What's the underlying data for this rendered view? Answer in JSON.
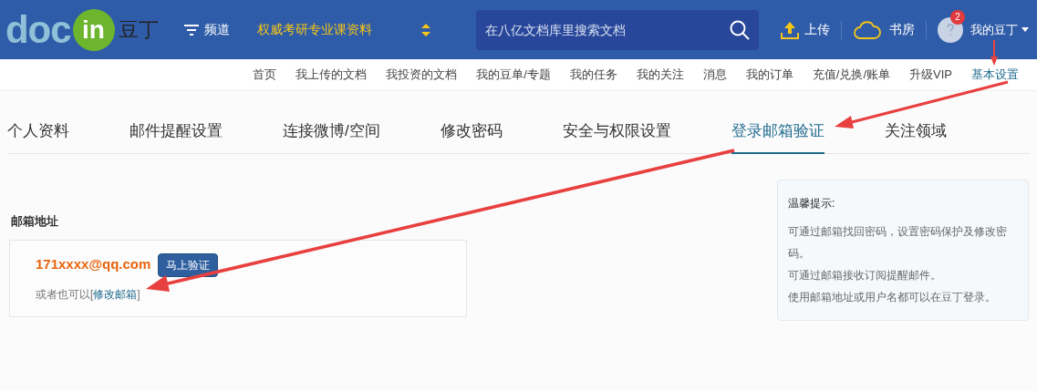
{
  "header": {
    "logo": {
      "part_1": "doc",
      "part_2": "in",
      "part_3": "豆丁"
    },
    "channel_menu": "频道",
    "promo": "权威考研专业课资料",
    "search": {
      "placeholder": "在八亿文档库里搜索文档"
    },
    "upload": "上传",
    "bookshelf": "书房",
    "account": {
      "name": "我的豆丁",
      "badge": "2"
    }
  },
  "nav": [
    {
      "label": "首页",
      "selected": false
    },
    {
      "label": "我上传的文档",
      "selected": false
    },
    {
      "label": "我投资的文档",
      "selected": false
    },
    {
      "label": "我的豆单/专题",
      "selected": false
    },
    {
      "label": "我的任务",
      "selected": false
    },
    {
      "label": "我的关注",
      "selected": false
    },
    {
      "label": "消息",
      "selected": false
    },
    {
      "label": "我的订单",
      "selected": false
    },
    {
      "label": "充值/兑换/账单",
      "selected": false
    },
    {
      "label": "升级VIP",
      "selected": false
    },
    {
      "label": "基本设置",
      "selected": true
    }
  ],
  "tabs": [
    {
      "label": "个人资料",
      "selected": false
    },
    {
      "label": "邮件提醒设置",
      "selected": false
    },
    {
      "label": "连接微博/空间",
      "selected": false
    },
    {
      "label": "修改密码",
      "selected": false
    },
    {
      "label": "安全与权限设置",
      "selected": false
    },
    {
      "label": "登录邮箱验证",
      "selected": true
    },
    {
      "label": "关注领域",
      "selected": false
    }
  ],
  "email_section": {
    "heading": "邮箱地址",
    "email": "171xxxx@qq.com",
    "verify_button": "马上验证",
    "alt_text": "或者也可以[",
    "alt_link": "修改邮箱",
    "alt_end": "]"
  },
  "tips": {
    "title": "温馨提示:",
    "lines": [
      "可通过邮箱找回密码，设置密码保护及修改密码。",
      "可通过邮箱接收订阅提醒邮件。",
      "使用邮箱地址或用户名都可以在豆丁登录。"
    ]
  }
}
